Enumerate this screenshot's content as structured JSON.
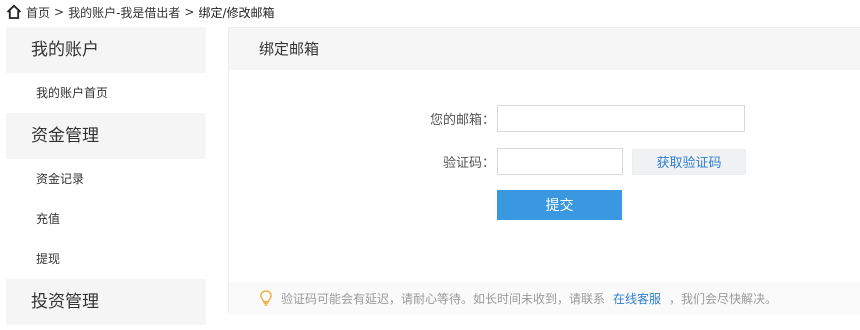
{
  "breadcrumb": {
    "home_icon": "home-icon",
    "items": [
      "首页",
      "我的账户-我是借出者"
    ],
    "separator": ">",
    "current": "绑定/修改邮箱"
  },
  "sidebar": {
    "groups": [
      {
        "title": "我的账户",
        "items": [
          "我的账户首页"
        ]
      },
      {
        "title": "资金管理",
        "items": [
          "资金记录",
          "充值",
          "提现"
        ]
      },
      {
        "title": "投资管理",
        "items": []
      }
    ]
  },
  "panel": {
    "title": "绑定邮箱",
    "form": {
      "email_label": "您的邮箱：",
      "email_value": "",
      "code_label": "验证码：",
      "code_value": "",
      "get_code_label": "获取验证码",
      "submit_label": "提交"
    },
    "notice": {
      "icon": "lightbulb-icon",
      "text_before": "验证码可能会有延迟，请耐心等待。如长时间未收到，请联系",
      "link": "在线客服",
      "text_after": "，我们会尽快解决。"
    }
  },
  "colors": {
    "accent": "#3a98e0",
    "link": "#2f7fcf",
    "sidebar_group_bg": "#f5f5f5",
    "notice_icon": "#f2a93b"
  }
}
